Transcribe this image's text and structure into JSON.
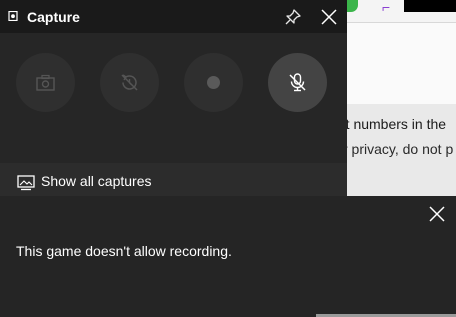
{
  "background_app": {
    "text_line_1": "rt numbers in the",
    "text_line_2": "r privacy, do not p"
  },
  "capture_widget": {
    "title": "Capture",
    "title_icon": "capture-widget-icon",
    "buttons": [
      {
        "name": "screenshot",
        "icon": "camera-icon",
        "enabled": false
      },
      {
        "name": "record-last",
        "icon": "record-that-icon",
        "enabled": false
      },
      {
        "name": "start-recording",
        "icon": "record-dot-icon",
        "enabled": false
      },
      {
        "name": "microphone",
        "icon": "microphone-off-icon",
        "enabled": true
      }
    ],
    "show_all_label": "Show all captures"
  },
  "toast": {
    "message": "This game doesn't allow recording."
  },
  "colors": {
    "widget_bg": "#262626",
    "header_bg": "#1a1a1a",
    "toast_bg": "#252525",
    "text": "#ffffff"
  }
}
